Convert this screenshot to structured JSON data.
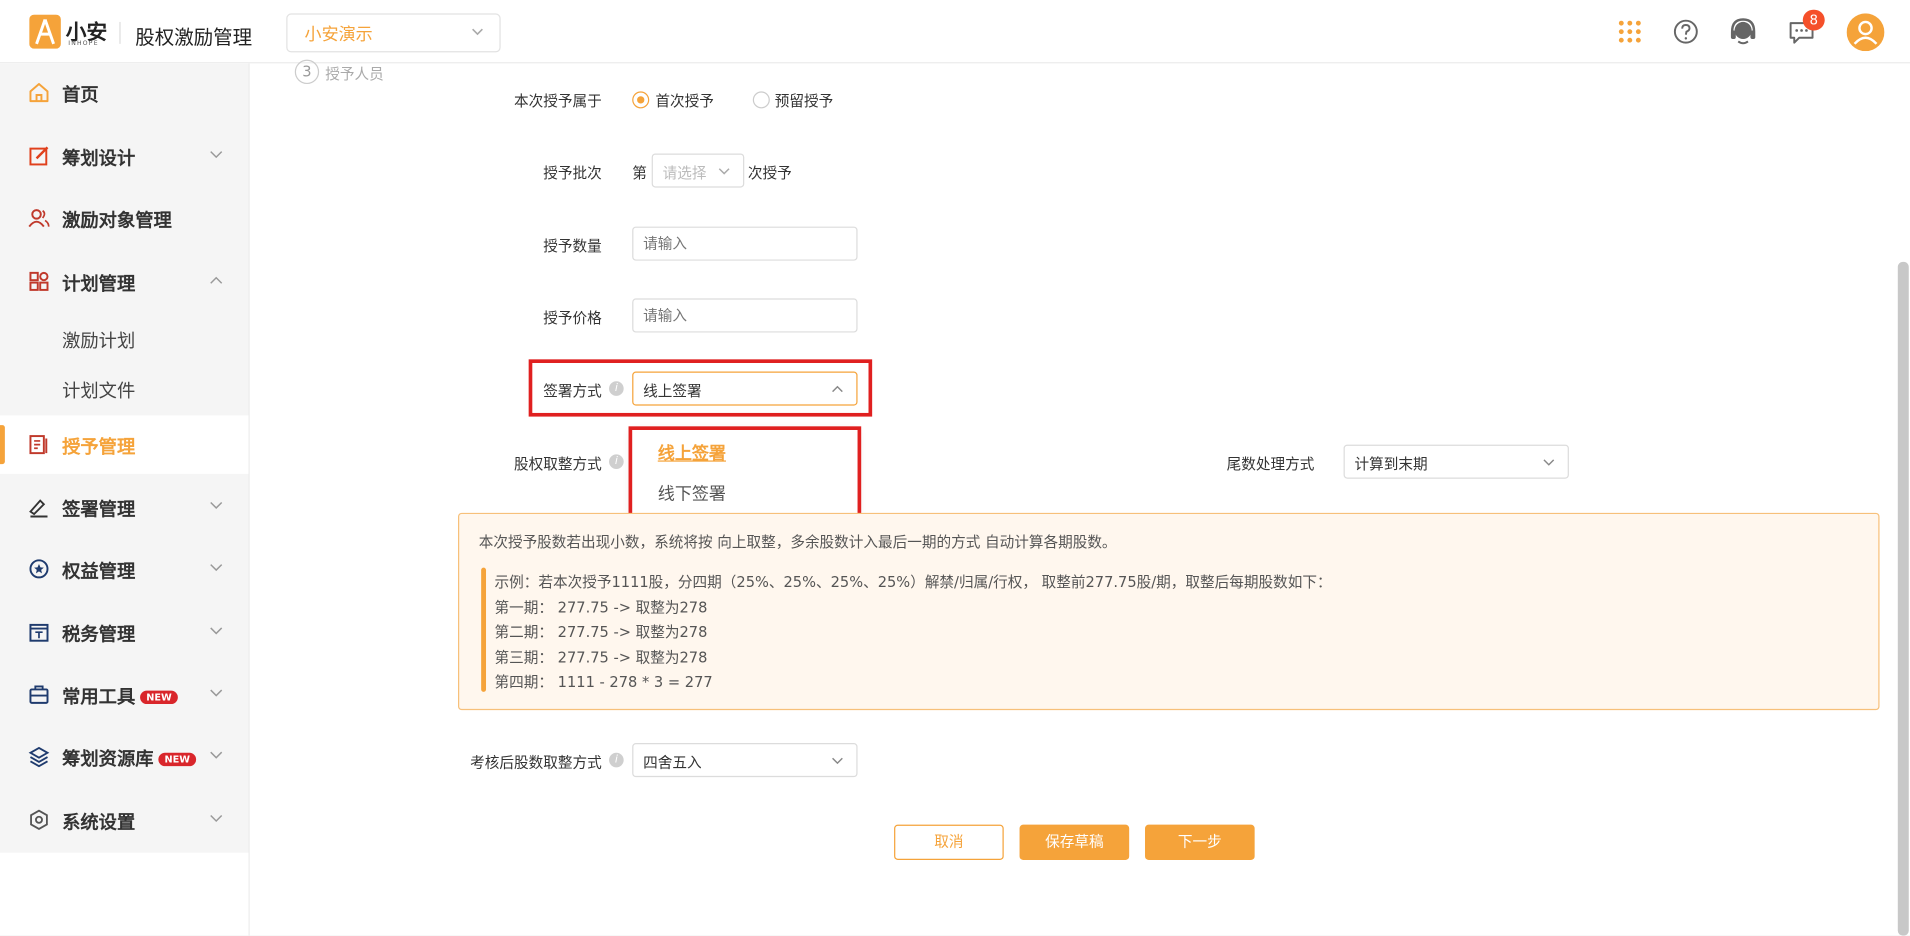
{
  "header": {
    "logo_text": "小安",
    "logo_sub": "INHOPE",
    "app_title": "股权激励管理",
    "company_selected": "小安演示",
    "notification_count": "8",
    "icons": [
      "apps-grid-icon",
      "help-icon",
      "support-headset-icon",
      "message-icon",
      "user-avatar-icon"
    ]
  },
  "sidebar": {
    "items": [
      {
        "label": "首页",
        "icon": "home-icon"
      },
      {
        "label": "筹划设计",
        "icon": "edit-icon"
      },
      {
        "label": "激励对象管理",
        "icon": "people-icon"
      },
      {
        "label": "计划管理",
        "icon": "grid-icon"
      },
      {
        "label": "激励计划",
        "icon": ""
      },
      {
        "label": "计划文件",
        "icon": ""
      },
      {
        "label": "授予管理",
        "icon": "book-icon"
      },
      {
        "label": "签署管理",
        "icon": "sign-icon"
      },
      {
        "label": "权益管理",
        "icon": "badge-icon"
      },
      {
        "label": "税务管理",
        "icon": "tax-icon"
      },
      {
        "label": "常用工具",
        "icon": "toolbox-icon"
      },
      {
        "label": "筹划资源库",
        "icon": "layers-icon"
      },
      {
        "label": "系统设置",
        "icon": "settings-icon"
      }
    ],
    "new_tag": "NEW"
  },
  "steps": {
    "number": "3",
    "label": "授予人员"
  },
  "form": {
    "grant_type_label": "本次授予属于",
    "grant_type_first": "首次授予",
    "grant_type_reserved": "预留授予",
    "batch_label": "授予批次",
    "batch_prefix": "第",
    "batch_placeholder": "请选择",
    "batch_suffix": "次授予",
    "quantity_label": "授予数量",
    "quantity_placeholder": "请输入",
    "price_label": "授予价格",
    "price_placeholder": "请输入",
    "sign_label": "签署方式",
    "sign_value": "线上签署",
    "sign_options": [
      "线上签署",
      "线下签署"
    ],
    "rounding_label": "股权取整方式",
    "remainder_label": "尾数处理方式",
    "remainder_value": "计算到末期",
    "post_review_label": "考核后股数取整方式",
    "post_review_value": "四舍五入"
  },
  "notice": {
    "main": "本次授予股数若出现小数，系统将按 向上取整，多余股数计入最后一期的方式 自动计算各期股数。",
    "lines": [
      "示例：若本次授予1111股，分四期（25%、25%、25%、25%）解禁/归属/行权， 取整前277.75股/期，取整后每期股数如下：",
      "第一期： 277.75 -> 取整为278",
      "第二期： 277.75 -> 取整为278",
      "第三期： 277.75 -> 取整为278",
      "第四期： 1111 - 278 * 3 = 277"
    ]
  },
  "buttons": {
    "cancel": "取消",
    "save_draft": "保存草稿",
    "next": "下一步"
  },
  "colors": {
    "accent": "#f5a33a",
    "highlight": "#e02020",
    "badge": "#f5502a"
  }
}
